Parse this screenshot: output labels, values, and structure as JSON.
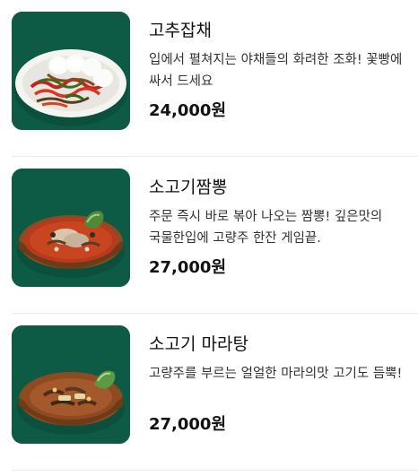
{
  "menu": {
    "items": [
      {
        "name": "고추잡채",
        "description": "입에서 펼쳐지는 야채들의 화려한 조화! 꽃빵에 싸서 드세요",
        "price": "24,000원",
        "image_icon": "japchae-plate-icon"
      },
      {
        "name": "소고기짬뽕",
        "description": "주문 즉시 바로 볶아 나오는 짬뽕! 깊은맛의 국물한입에 고량주 한잔 게임끝.",
        "price": "27,000원",
        "image_icon": "jjamppong-pot-icon"
      },
      {
        "name": "소고기 마라탕",
        "description": "고량주를 부르는 얼얼한 마라의맛 고기도 듬뿍!",
        "price": "27,000원",
        "image_icon": "malatang-pot-icon"
      }
    ],
    "colors": {
      "thumb_background": "#0f5a45",
      "divider": "#ececec",
      "price": "#111111"
    }
  }
}
